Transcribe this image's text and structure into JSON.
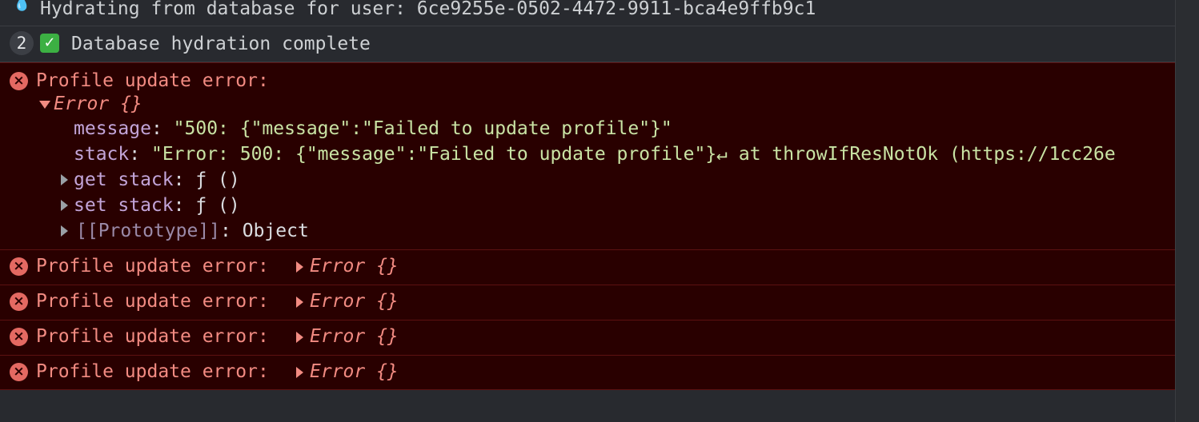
{
  "console": {
    "hydrating_log": "Hydrating from database for user: 6ce9255e-0502-4472-9911-bca4e9ffb9c1",
    "hydration_complete": {
      "count": "2",
      "text": "Database hydration complete"
    },
    "expanded_error": {
      "label": "Profile update error:",
      "object_label": "Error {}",
      "message_key": "message",
      "message_value": "\"500: {\"message\":\"Failed to update profile\"}\"",
      "stack_key": "stack",
      "stack_value": "\"Error: 500: {\"message\":\"Failed to update profile\"}↵ at throwIfResNotOk (https://1cc26e",
      "get_stack_key": "get stack",
      "get_stack_value": "ƒ ()",
      "set_stack_key": "set stack",
      "set_stack_value": "ƒ ()",
      "prototype_key": "[[Prototype]]",
      "prototype_value": "Object",
      "colon": ":"
    },
    "collapsed_errors": [
      {
        "label": "Profile update error:",
        "object_label": "Error {}"
      },
      {
        "label": "Profile update error:",
        "object_label": "Error {}"
      },
      {
        "label": "Profile update error:",
        "object_label": "Error {}"
      },
      {
        "label": "Profile update error:",
        "object_label": "Error {}"
      }
    ],
    "icons": {
      "error": "error-circle-icon",
      "check": "check-mark-icon",
      "droplet": "droplet-icon"
    }
  }
}
